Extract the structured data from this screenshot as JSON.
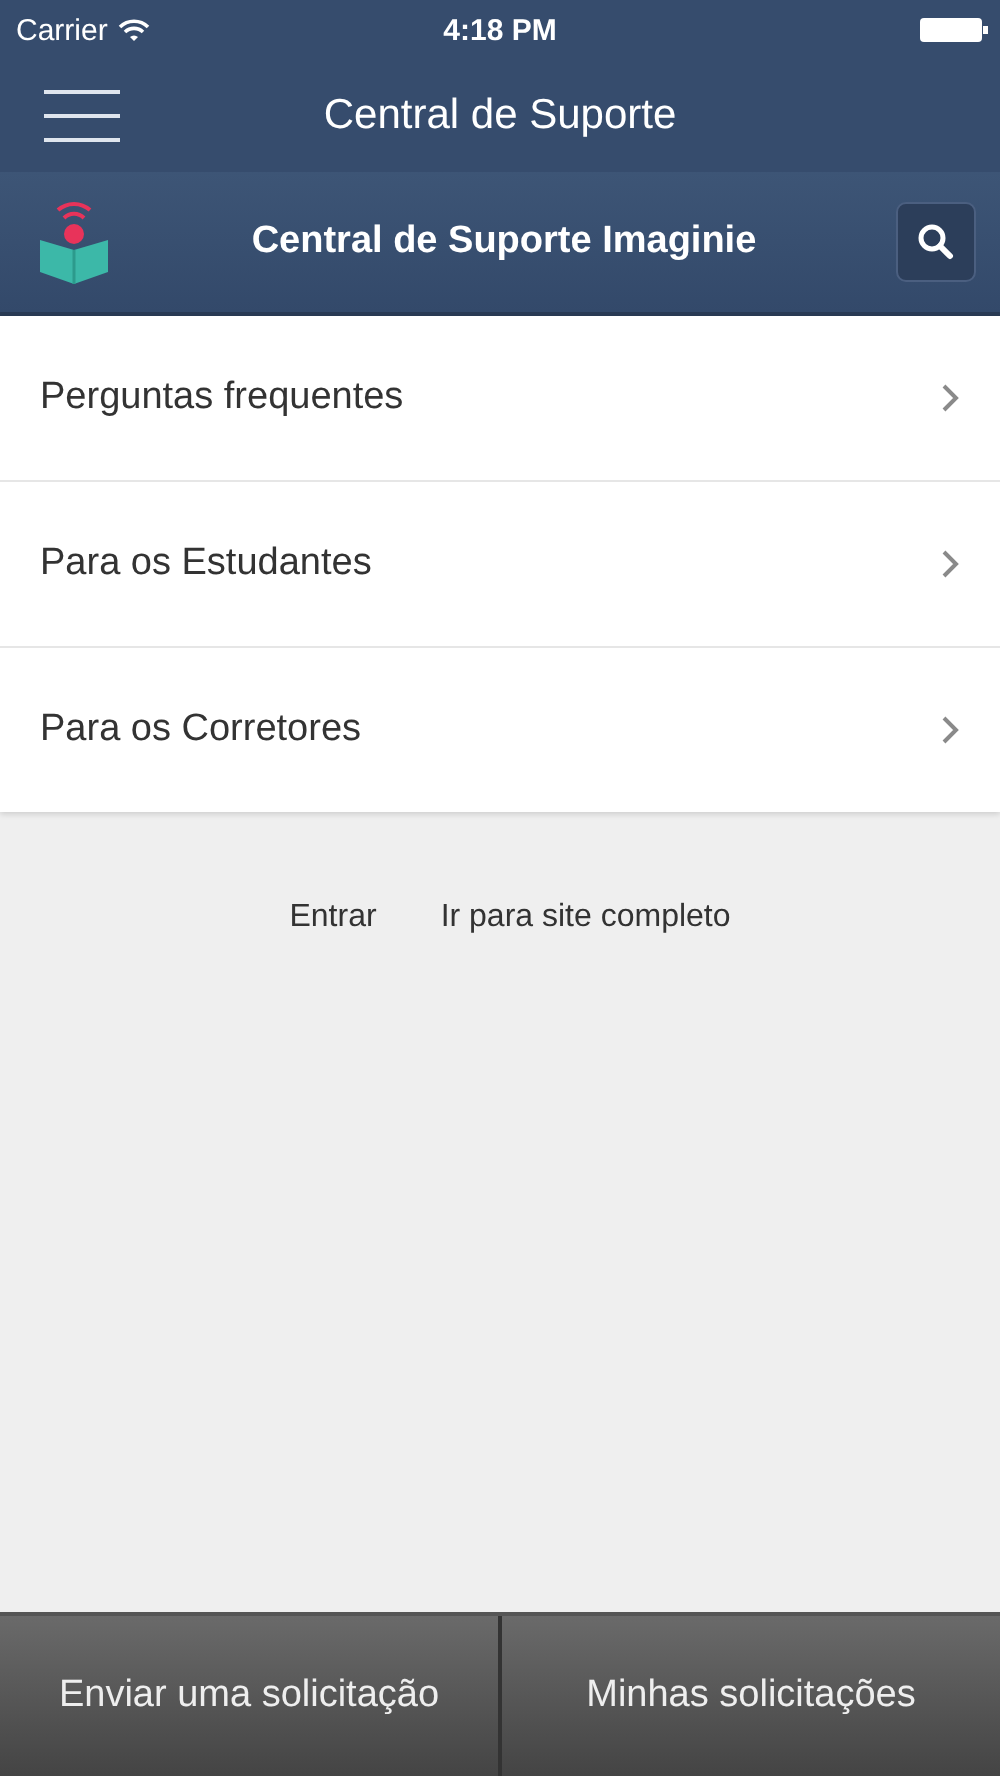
{
  "status_bar": {
    "carrier": "Carrier",
    "time": "4:18 PM"
  },
  "nav_bar": {
    "title": "Central de Suporte"
  },
  "header": {
    "title": "Central de Suporte Imaginie"
  },
  "menu_items": [
    {
      "label": "Perguntas frequentes"
    },
    {
      "label": "Para os Estudantes"
    },
    {
      "label": "Para os Corretores"
    }
  ],
  "links": [
    "Entrar",
    "Ir para site completo"
  ],
  "bottom_buttons": [
    "Enviar uma solicitação",
    "Minhas solicitações"
  ]
}
